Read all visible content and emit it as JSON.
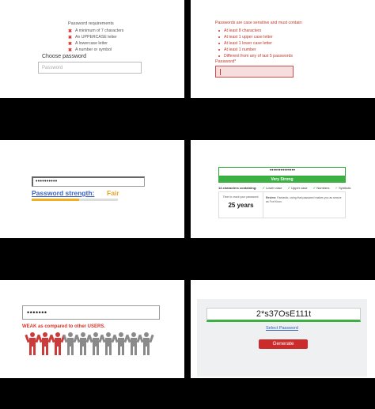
{
  "panel1": {
    "requirements_title": "Password requirements",
    "requirements": [
      "A minimum of 7 characters",
      "An UPPERCASE letter",
      "A lowercase letter",
      "A number or symbol"
    ],
    "field_label": "Choose password",
    "field_placeholder": "Password"
  },
  "panel2": {
    "heading": "Passwords are case sensitive and must contain:",
    "rules": [
      "At least 8 characters",
      "At least 1 upper case letter",
      "At least 1 lower case letter",
      "At least 1 number",
      "Different from any of last 5 passwords"
    ],
    "field_label": "Password*"
  },
  "panel3": {
    "masked_value": "••••••••••",
    "strength_label": "Password strength:",
    "strength_value": "Fair",
    "strength_fraction": 0.55
  },
  "panel4": {
    "masked_value": "••••••••••••••",
    "banner": "Very Strong",
    "chars_label": "14 characters containing:",
    "checks": [
      "Lower case",
      "Upper case",
      "Numbers",
      "Symbols"
    ],
    "crack_text": "Time to crack your password:",
    "crack_value": "25 years",
    "review_label": "Review:",
    "review_text": "Fantastic, using that password makes you as secure as Fort Knox."
  },
  "panel5": {
    "masked_value": "•••••••",
    "weak_text": "WEAK as compared to other USERS.",
    "people_total": 10,
    "people_highlighted": 3
  },
  "panel6": {
    "generated_password": "2*s37OsE111t",
    "select_link": "Select Password",
    "generate_button": "Generate"
  },
  "colors": {
    "error_red": "#c0392b",
    "success_green": "#3cb043",
    "fair_orange": "#f0a320",
    "link_blue": "#2f5fb3"
  },
  "icons": {
    "requirement_fail": "x-mark-icon",
    "check": "check-icon",
    "person": "person-icon"
  }
}
